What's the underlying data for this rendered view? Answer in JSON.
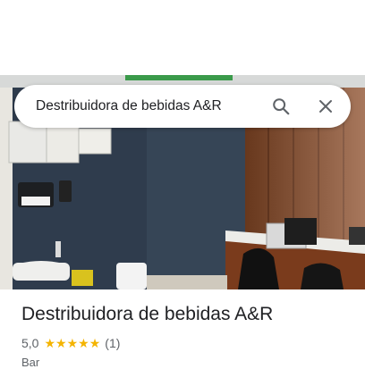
{
  "search": {
    "query": "Destribuidora de bebidas A&R"
  },
  "place": {
    "title": "Destribuidora de bebidas A&R",
    "rating": "5,0",
    "stars": 5,
    "reviews": "(1)",
    "category": "Bar"
  },
  "colors": {
    "star": "#f4b400",
    "wall": "#2e3a4a",
    "wood": "#8a4a26"
  },
  "icons": {
    "search": "search-icon",
    "close": "close-icon"
  }
}
